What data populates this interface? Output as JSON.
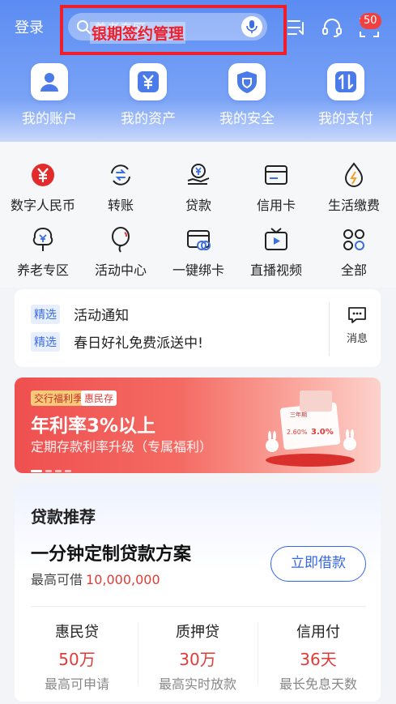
{
  "header": {
    "login": "登录",
    "search_placeholder": "养老专区",
    "highlight_label": "银期签约管理",
    "highlight_color": "#ee1f2b",
    "right_icons": [
      "scan-transfer-icon",
      "headset-icon",
      "scan-icon"
    ]
  },
  "main_actions": [
    {
      "label": "我的账户",
      "icon": "person-icon"
    },
    {
      "label": "我的资产",
      "icon": "yen-icon"
    },
    {
      "label": "我的安全",
      "icon": "shield-icon"
    },
    {
      "label": "我的支付",
      "icon": "transfer-arrows-icon"
    }
  ],
  "services": [
    {
      "label": "数字人民币",
      "icon": "digital-rmb-icon"
    },
    {
      "label": "转账",
      "icon": "transfer-icon"
    },
    {
      "label": "贷款",
      "icon": "loan-icon"
    },
    {
      "label": "信用卡",
      "icon": "credit-card-icon"
    },
    {
      "label": "生活缴费",
      "icon": "utility-icon"
    },
    {
      "label": "养老专区",
      "icon": "pension-icon"
    },
    {
      "label": "活动中心",
      "icon": "balloon-icon"
    },
    {
      "label": "一键绑卡",
      "icon": "bind-card-icon"
    },
    {
      "label": "直播视频",
      "icon": "live-video-icon"
    },
    {
      "label": "全部",
      "icon": "all-icon"
    }
  ],
  "notices": [
    {
      "tag": "精选",
      "text": "活动通知"
    },
    {
      "tag": "精选",
      "text": "春日好礼免费派送中!"
    }
  ],
  "message": {
    "label": "消息",
    "badge": "50"
  },
  "banner": {
    "tag1": "交行福利季",
    "tag2": "惠民存",
    "title": "年利率3%以上",
    "subtitle": "定期存款利率升级（专属福利）",
    "art_label": "三年期",
    "art_rate1": "2.60%",
    "art_rate2": "3.0%"
  },
  "loan": {
    "title": "贷款推荐",
    "headline": "一分钟定制贷款方案",
    "limit_label": "最高可借",
    "limit_value": "10,000,000",
    "button": "立即借款",
    "products": [
      {
        "name": "惠民贷",
        "value": "50万",
        "desc": "最高可申请"
      },
      {
        "name": "质押贷",
        "value": "30万",
        "desc": "最高实时放款"
      },
      {
        "name": "信用付",
        "value": "36天",
        "desc": "最长免息天数"
      }
    ]
  }
}
